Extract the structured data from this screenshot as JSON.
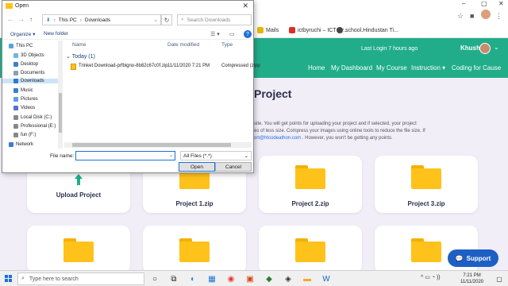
{
  "dialog": {
    "title": "Open",
    "breadcrumb": [
      "This PC",
      "Downloads"
    ],
    "search_placeholder": "Search Downloads",
    "toolbar": {
      "organize": "Organize ▾",
      "new_folder": "New folder"
    },
    "nav_items": [
      {
        "label": "This PC",
        "icon": "computer-icon",
        "color": "#5aa0e0"
      },
      {
        "label": "3D Objects",
        "icon": "cube-icon",
        "color": "#6cb5e6"
      },
      {
        "label": "Desktop",
        "icon": "desktop-icon",
        "color": "#3a7fd0"
      },
      {
        "label": "Documents",
        "icon": "document-icon",
        "color": "#8a9fb8"
      },
      {
        "label": "Downloads",
        "icon": "download-icon",
        "color": "#2a7ad6"
      },
      {
        "label": "Music",
        "icon": "music-icon",
        "color": "#3a7fd0"
      },
      {
        "label": "Pictures",
        "icon": "picture-icon",
        "color": "#5aa0e0"
      },
      {
        "label": "Videos",
        "icon": "video-icon",
        "color": "#5a6fd0"
      },
      {
        "label": "Local Disk (C:)",
        "icon": "disk-icon",
        "color": "#888888"
      },
      {
        "label": "Professional (E:)",
        "icon": "disk-icon",
        "color": "#888888"
      },
      {
        "label": "fun (F:)",
        "icon": "disk-icon",
        "color": "#888888"
      },
      {
        "label": "Network",
        "icon": "network-icon",
        "color": "#3a7fd0"
      }
    ],
    "columns": {
      "name": "Name",
      "date": "Date modified",
      "type": "Type"
    },
    "group": "Today (1)",
    "files": [
      {
        "name": "Trinket Download-prfbigno-8b82c67c0f.zip",
        "date": "11/11/2020 7:21 PM",
        "type": "Compressed (zipp"
      }
    ],
    "file_name_label": "File name:",
    "file_name_value": "",
    "file_type": "All Files (*.*)",
    "open_label": "Open",
    "cancel_label": "Cancel"
  },
  "bookmarks": [
    {
      "label": "Mails",
      "color": "#e6b800"
    },
    {
      "label": "ictbyruchi – ICT by...",
      "color": "#d93025"
    },
    {
      "label": "school.Hindustan Ti...",
      "color": "#444444"
    }
  ],
  "site": {
    "login_text": "Last Login 7 hours ago",
    "user_name": "Khushi",
    "nav": [
      "Home",
      "My Dashboard",
      "My Course",
      "Instruction ▾",
      "Coding for Cause"
    ],
    "page_title": "Project",
    "desc_line1": "site. You will get points for uploading your project and if selected, your project",
    "desc_line2": "es of less size. Compress your images using online tools to reduce the file size. If",
    "desc_link": "ort@htcodeathon.com",
    "desc_line3_tail": ". However, you won't be getting any points.",
    "cards": [
      {
        "label": "Upload Project",
        "kind": "upload"
      },
      {
        "label": "Project 1.zip",
        "kind": "folder"
      },
      {
        "label": "Project 2.zip",
        "kind": "folder"
      },
      {
        "label": "Project 3.zip",
        "kind": "folder"
      }
    ],
    "support_label": "Support",
    "accent": "#21ad8a"
  },
  "taskbar": {
    "search_placeholder": "Type here to search",
    "time": "7:21 PM",
    "date": "11/11/2020"
  }
}
